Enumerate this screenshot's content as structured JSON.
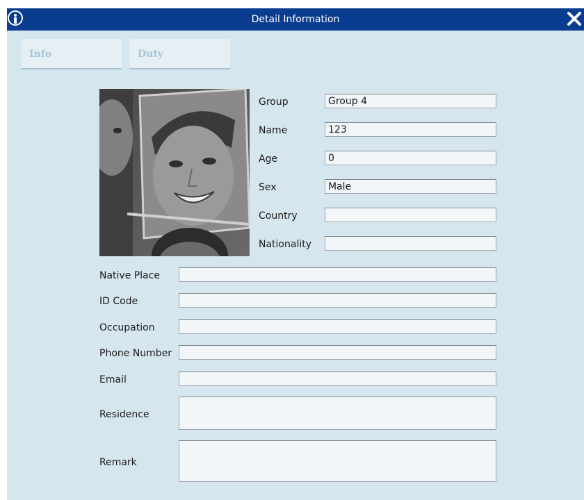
{
  "window": {
    "title": "Detail Information"
  },
  "tabs": [
    {
      "label": "Info"
    },
    {
      "label": "Duty"
    }
  ],
  "fields": {
    "group": {
      "label": "Group",
      "value": "Group 4"
    },
    "name": {
      "label": "Name",
      "value": "123"
    },
    "age": {
      "label": "Age",
      "value": "0"
    },
    "sex": {
      "label": "Sex",
      "value": "Male"
    },
    "country": {
      "label": "Country",
      "value": ""
    },
    "nationality": {
      "label": "Nationality",
      "value": ""
    },
    "native_place": {
      "label": "Native Place",
      "value": ""
    },
    "id_code": {
      "label": "ID Code",
      "value": ""
    },
    "occupation": {
      "label": "Occupation",
      "value": ""
    },
    "phone_number": {
      "label": "Phone Number",
      "value": ""
    },
    "email": {
      "label": "Email",
      "value": ""
    },
    "residence": {
      "label": "Residence",
      "value": ""
    },
    "remark": {
      "label": "Remark",
      "value": ""
    }
  },
  "icons": {
    "title": "info-icon",
    "close": "close-icon"
  },
  "colors": {
    "titlebar": "#0a3d8f",
    "background": "#d6e6ee",
    "tab_text": "#a8c6da"
  }
}
